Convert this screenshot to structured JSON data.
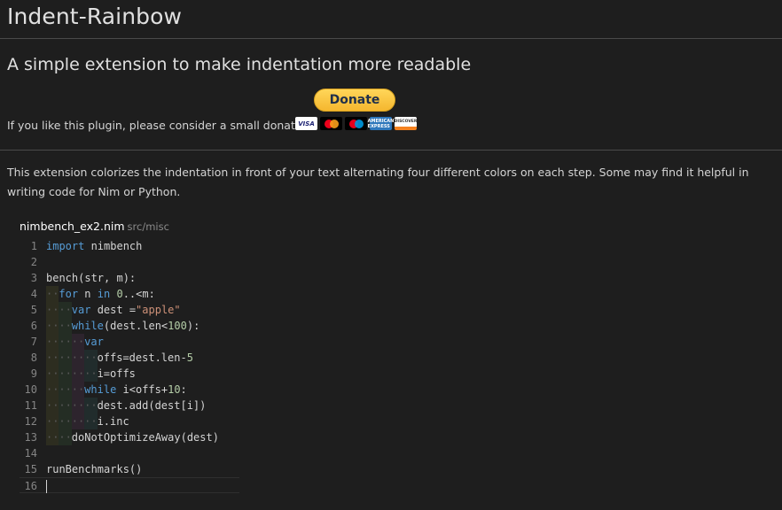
{
  "header": {
    "title": "Indent-Rainbow",
    "subtitle": "A simple extension to make indentation more readable"
  },
  "donation": {
    "button_label": "Donate",
    "prompt": "If you like this plugin, please consider a small donation:",
    "cards": [
      "VISA",
      "mastercard-icon",
      "maestro-icon",
      "AMERICAN EXPRESS",
      "DISCOVER"
    ]
  },
  "description": "This extension colorizes the indentation in front of your text alternating four different colors on each step. Some may find it helpful in writing code for Nim or Python.",
  "file": {
    "name": "nimbench_ex2.nim",
    "path": "src/misc"
  },
  "indent_colors": [
    "rgba(255,255,64,0.07)",
    "rgba(127,255,127,0.07)",
    "rgba(255,127,255,0.07)",
    "rgba(79,236,236,0.07)"
  ],
  "code_lines": [
    {
      "n": "1",
      "indent": 0,
      "tokens": [
        [
          "kw",
          "import"
        ],
        [
          "plain",
          " nimbench"
        ]
      ]
    },
    {
      "n": "2",
      "indent": 0,
      "tokens": []
    },
    {
      "n": "3",
      "indent": 0,
      "tokens": [
        [
          "plain",
          "bench(str, m):"
        ]
      ]
    },
    {
      "n": "4",
      "indent": 1,
      "tokens": [
        [
          "kw",
          "for"
        ],
        [
          "plain",
          " n "
        ],
        [
          "kw",
          "in"
        ],
        [
          "plain",
          " "
        ],
        [
          "num",
          "0"
        ],
        [
          "plain",
          "..<m:"
        ]
      ]
    },
    {
      "n": "5",
      "indent": 2,
      "tokens": [
        [
          "kw",
          "var"
        ],
        [
          "plain",
          " dest ="
        ],
        [
          "str",
          "\"apple\""
        ]
      ]
    },
    {
      "n": "6",
      "indent": 2,
      "tokens": [
        [
          "kw",
          "while"
        ],
        [
          "plain",
          "(dest.len<"
        ],
        [
          "num",
          "100"
        ],
        [
          "plain",
          "):"
        ]
      ]
    },
    {
      "n": "7",
      "indent": 3,
      "tokens": [
        [
          "kw",
          "var"
        ]
      ]
    },
    {
      "n": "8",
      "indent": 4,
      "tokens": [
        [
          "plain",
          "offs=dest.len-"
        ],
        [
          "num",
          "5"
        ]
      ]
    },
    {
      "n": "9",
      "indent": 4,
      "tokens": [
        [
          "plain",
          "i=offs"
        ]
      ]
    },
    {
      "n": "10",
      "indent": 3,
      "tokens": [
        [
          "kw",
          "while"
        ],
        [
          "plain",
          " i<offs+"
        ],
        [
          "num",
          "10"
        ],
        [
          "plain",
          ":"
        ]
      ]
    },
    {
      "n": "11",
      "indent": 4,
      "tokens": [
        [
          "plain",
          "dest.add(dest[i])"
        ]
      ]
    },
    {
      "n": "12",
      "indent": 4,
      "tokens": [
        [
          "plain",
          "i.inc"
        ]
      ]
    },
    {
      "n": "13",
      "indent": 2,
      "tokens": [
        [
          "plain",
          "doNotOptimizeAway(dest)"
        ]
      ]
    },
    {
      "n": "14",
      "indent": 0,
      "tokens": []
    },
    {
      "n": "15",
      "indent": 0,
      "tokens": [
        [
          "plain",
          "runBenchmarks()"
        ]
      ]
    },
    {
      "n": "16",
      "indent": 0,
      "tokens": [],
      "current": true
    }
  ]
}
